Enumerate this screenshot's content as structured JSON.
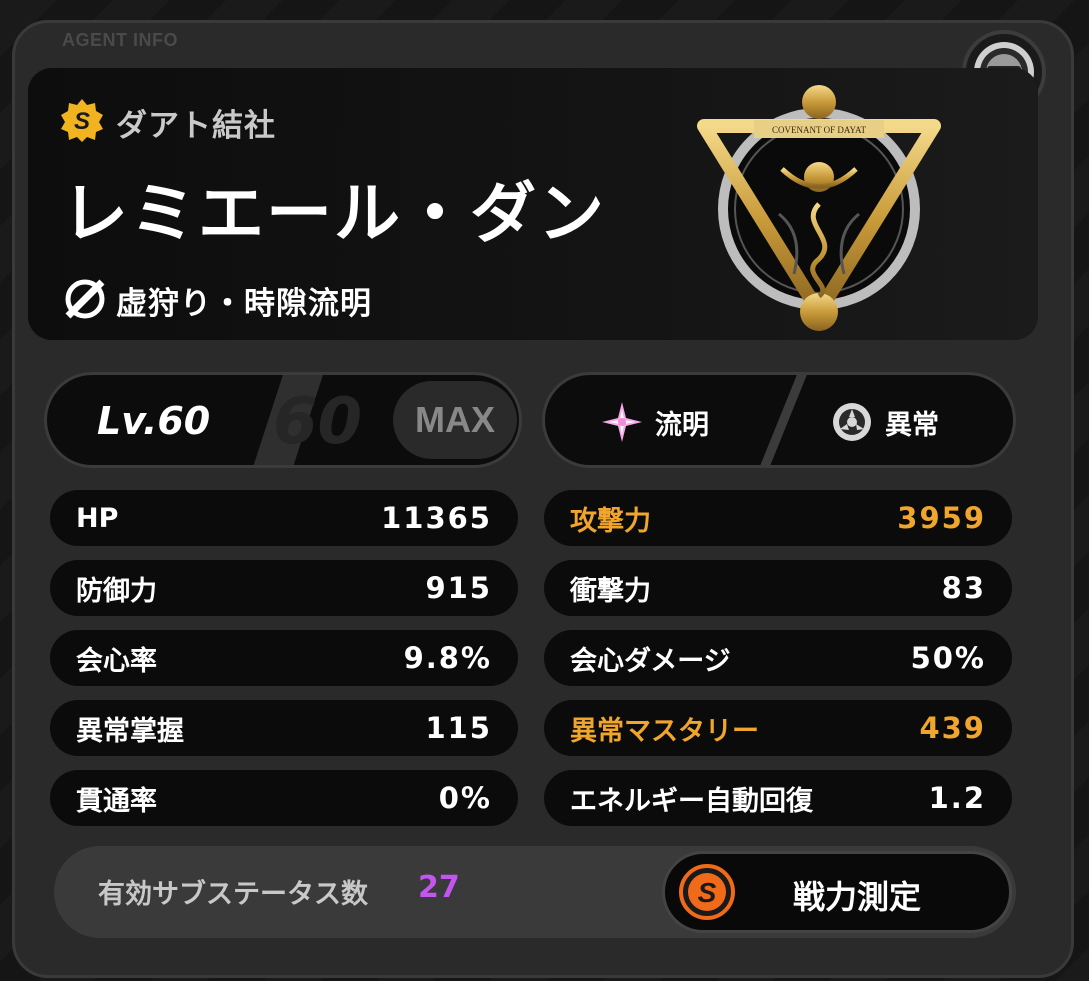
{
  "section_label": "AGENT INFO",
  "agent": {
    "rank": "S",
    "faction": "ダアト結社",
    "name": "レミエール・ダン",
    "path": "虚狩り・時隙流明"
  },
  "emblem_text": "COVENANT OF DAYAT",
  "level": {
    "label": "Lv.60",
    "ghost": "60",
    "max": "MAX"
  },
  "types": [
    {
      "label": "流明",
      "icon": "spark-star-icon"
    },
    {
      "label": "異常",
      "icon": "anomaly-wheel-icon"
    }
  ],
  "stats_left": [
    {
      "label": "HP",
      "value": "11365",
      "highlight": false
    },
    {
      "label": "防御力",
      "value": "915",
      "highlight": false
    },
    {
      "label": "会心率",
      "value": "9.8%",
      "highlight": false
    },
    {
      "label": "異常掌握",
      "value": "115",
      "highlight": false
    },
    {
      "label": "貫通率",
      "value": "0%",
      "highlight": false
    }
  ],
  "stats_right": [
    {
      "label": "攻撃力",
      "value": "3959",
      "highlight": true
    },
    {
      "label": "衝撃力",
      "value": "83",
      "highlight": false
    },
    {
      "label": "会心ダメージ",
      "value": "50%",
      "highlight": false
    },
    {
      "label": "異常マスタリー",
      "value": "439",
      "highlight": true
    },
    {
      "label": "エネルギー自動回復",
      "value": "1.2",
      "highlight": false
    }
  ],
  "substats": {
    "label": "有効サブステータス数",
    "count": "27"
  },
  "measure_button": {
    "label": "戦力測定",
    "badge": "S"
  },
  "colors": {
    "highlight": "#f0a52c",
    "rank_gold": "#f2b320",
    "substat_count": "#c455f0",
    "badge_orange": "#f06a1a"
  }
}
